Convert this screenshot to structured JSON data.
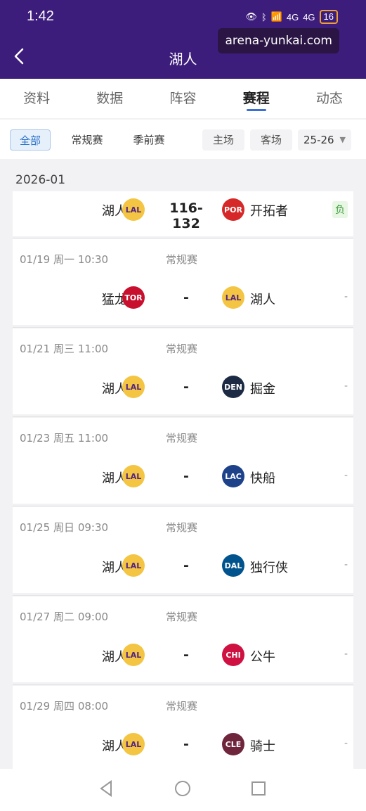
{
  "status": {
    "time": "1:42",
    "battery": "16"
  },
  "watermark": "arena-yunkai.com",
  "header": {
    "title": "湖人"
  },
  "tabs": [
    {
      "label": "资料",
      "active": false
    },
    {
      "label": "数据",
      "active": false
    },
    {
      "label": "阵容",
      "active": false
    },
    {
      "label": "赛程",
      "active": true
    },
    {
      "label": "动态",
      "active": false
    }
  ],
  "filters": {
    "all": "全部",
    "regular": "常规赛",
    "preseason": "季前赛",
    "home": "主场",
    "away": "客场",
    "season": "25-26"
  },
  "month": "2026-01",
  "first_match": {
    "home": "湖人",
    "home_abbr": "LAL",
    "score": "116-132",
    "away": "开拓者",
    "away_abbr": "POR",
    "result": "负"
  },
  "matches": [
    {
      "date": "01/19",
      "weekday": "周一",
      "time": "10:30",
      "type": "常规赛",
      "home": "猛龙",
      "home_abbr": "TOR",
      "away": "湖人",
      "away_abbr": "LAL",
      "score": "-",
      "result": "-"
    },
    {
      "date": "01/21",
      "weekday": "周三",
      "time": "11:00",
      "type": "常规赛",
      "home": "湖人",
      "home_abbr": "LAL",
      "away": "掘金",
      "away_abbr": "DEN",
      "score": "-",
      "result": "-"
    },
    {
      "date": "01/23",
      "weekday": "周五",
      "time": "11:00",
      "type": "常规赛",
      "home": "湖人",
      "home_abbr": "LAL",
      "away": "快船",
      "away_abbr": "LAC",
      "score": "-",
      "result": "-"
    },
    {
      "date": "01/25",
      "weekday": "周日",
      "time": "09:30",
      "type": "常规赛",
      "home": "湖人",
      "home_abbr": "LAL",
      "away": "独行侠",
      "away_abbr": "DAL",
      "score": "-",
      "result": "-"
    },
    {
      "date": "01/27",
      "weekday": "周二",
      "time": "09:00",
      "type": "常规赛",
      "home": "湖人",
      "home_abbr": "LAL",
      "away": "公牛",
      "away_abbr": "CHI",
      "score": "-",
      "result": "-"
    },
    {
      "date": "01/29",
      "weekday": "周四",
      "time": "08:00",
      "type": "常规赛",
      "home": "湖人",
      "home_abbr": "LAL",
      "away": "骑士",
      "away_abbr": "CLE",
      "score": "-",
      "result": "-"
    }
  ],
  "colors": {
    "header_bg": "#3d1d7c",
    "tab_indicator": "#3a6fd8",
    "LAL": "#f4c542",
    "POR": "#d62828",
    "TOR": "#c8102e",
    "DEN": "#1d2a44",
    "LAC": "#1d428a",
    "DAL": "#00538c",
    "CHI": "#ce1141",
    "CLE": "#6f263d"
  }
}
